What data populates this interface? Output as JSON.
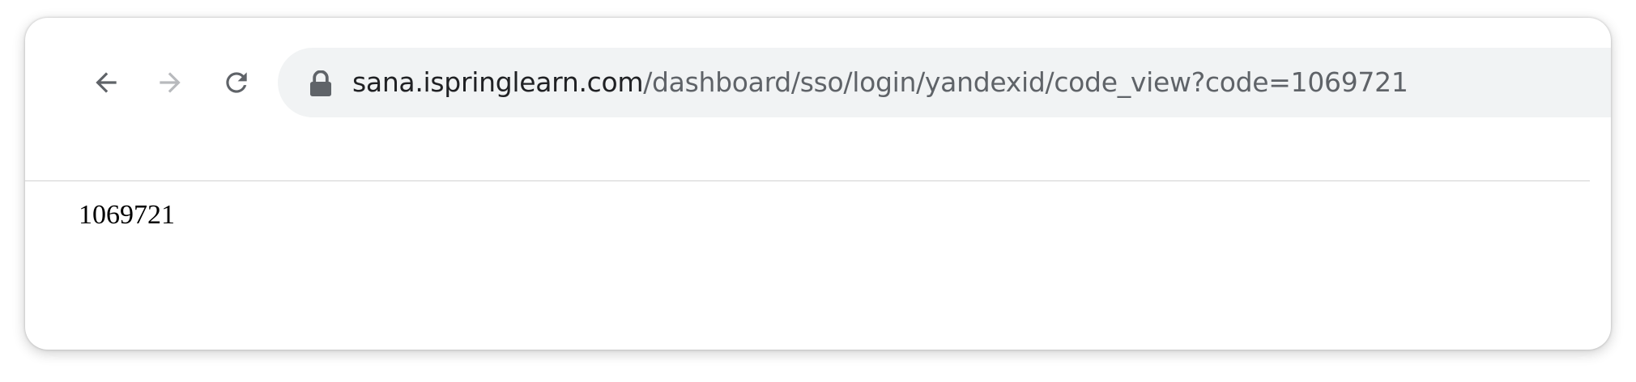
{
  "toolbar": {
    "back_icon": "arrow-left-icon",
    "forward_icon": "arrow-right-icon",
    "reload_icon": "reload-icon"
  },
  "address_bar": {
    "security_icon": "lock-icon",
    "host": "sana.ispringlearn.com",
    "path": "/dashboard/sso/login/yandexid/code_view?code=1069721"
  },
  "page": {
    "body_text": "1069721"
  },
  "colors": {
    "omnibox_background": "#f1f3f4",
    "host_text": "#202124",
    "path_text": "#5f6368",
    "icon_active": "#5f6368",
    "icon_disabled": "#b8babd"
  }
}
